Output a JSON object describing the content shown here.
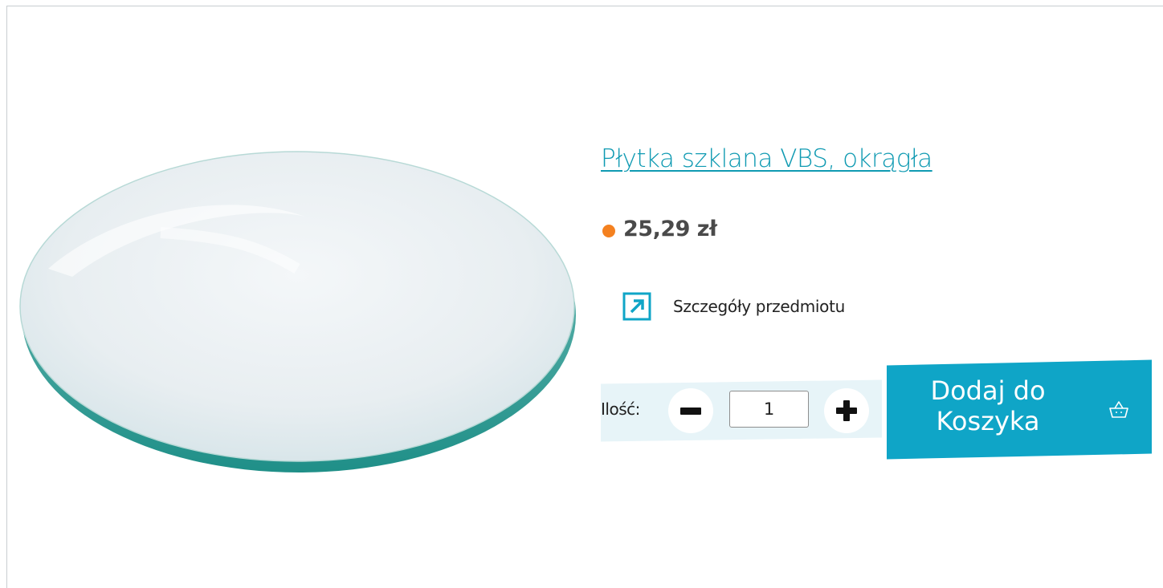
{
  "product": {
    "title": "Płytka szklana VBS, okrągła",
    "price": "25,29 zł",
    "details_label": "Szczegóły przedmiotu",
    "image_icon": "glass-plate-image"
  },
  "quantity": {
    "label": "Ilość:",
    "value": "1",
    "minus_icon": "minus-icon",
    "plus_icon": "plus-icon"
  },
  "cart": {
    "button_label_line1": "Dodaj do",
    "button_label_line2": "Koszyka",
    "icon": "basket-icon"
  },
  "colors": {
    "accent": "#0fa5c7",
    "title_link": "#0f9ab2",
    "price_dot": "#f48120",
    "quantity_panel": "#e7f4f8"
  }
}
